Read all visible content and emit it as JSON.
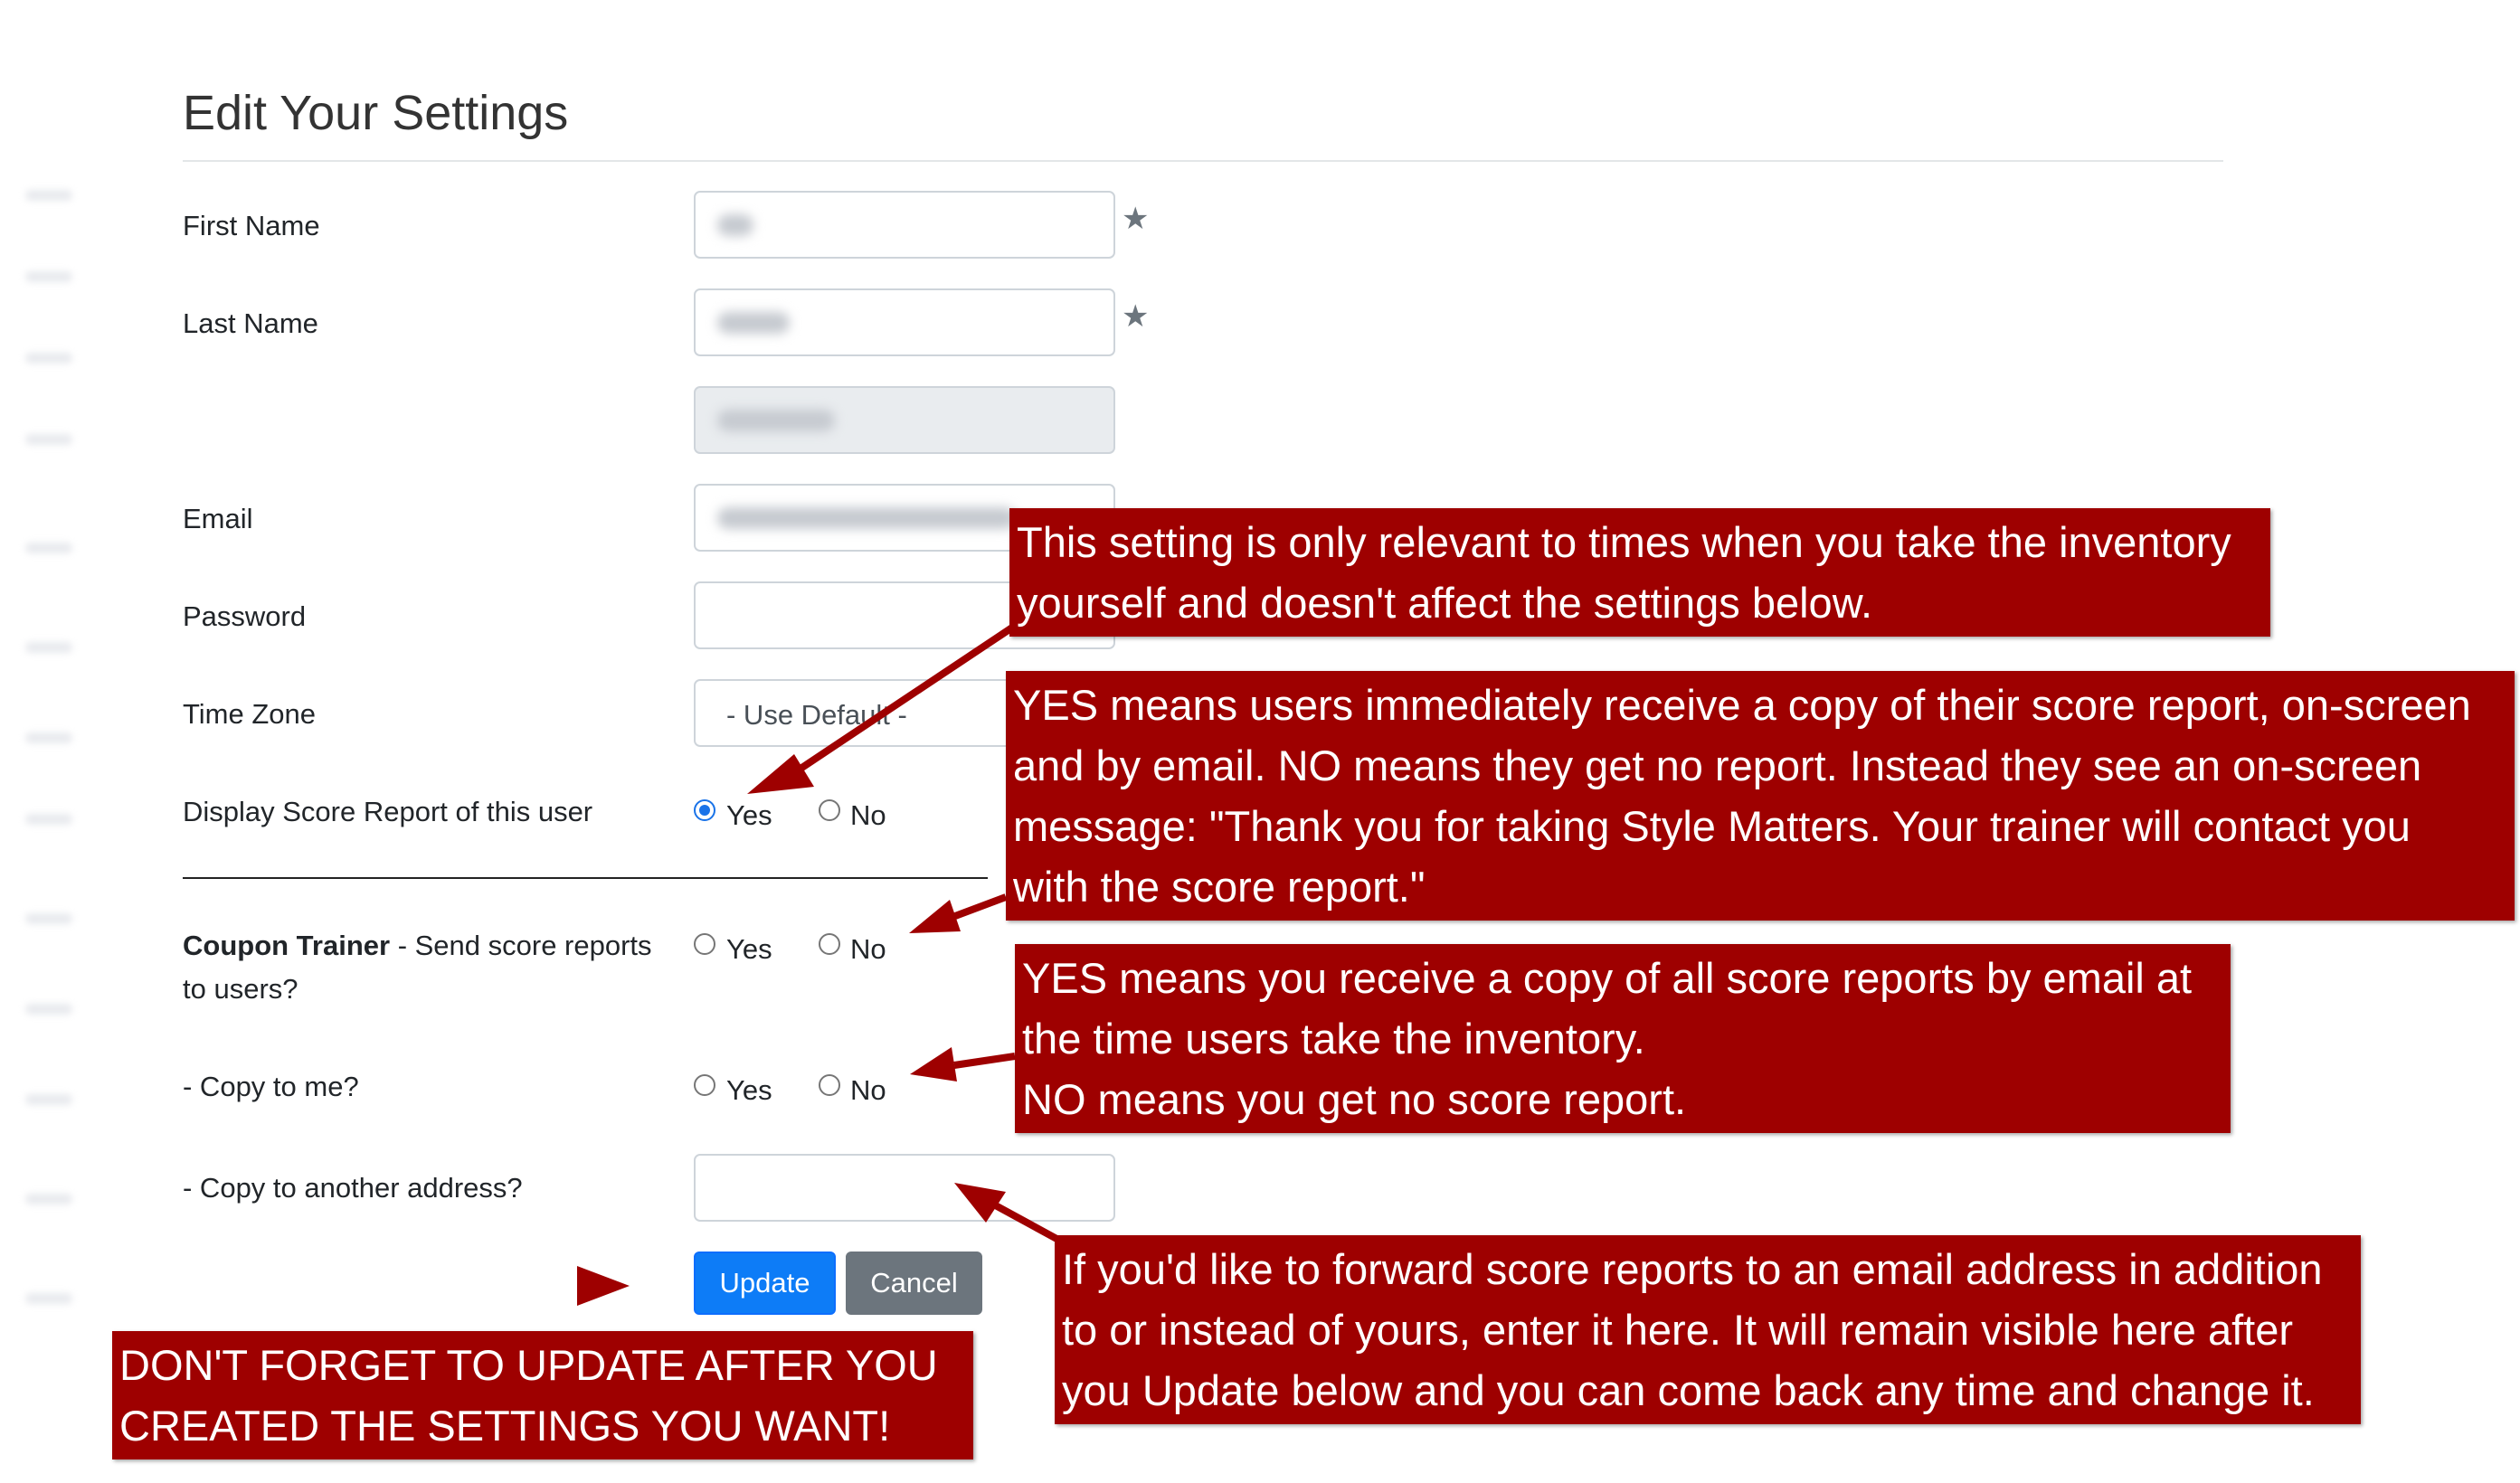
{
  "page": {
    "title": "Edit Your Settings"
  },
  "form": {
    "first_name_label": "First Name",
    "last_name_label": "Last Name",
    "email_label": "Email",
    "password_label": "Password",
    "time_zone_label": "Time Zone",
    "time_zone_value": "- Use Default -",
    "display_report_label": "Display Score Report of this user",
    "coupon_trainer_bold": "Coupon Trainer",
    "coupon_trainer_rest": " - Send score reports",
    "coupon_trainer_line2": "to users?",
    "copy_to_me_label": "- Copy to me?",
    "copy_to_other_label": "- Copy to another address?",
    "yes": "Yes",
    "no": "No",
    "required_icon": "star-icon"
  },
  "buttons": {
    "update": "Update",
    "cancel": "Cancel"
  },
  "annotations": {
    "note1": [
      "This setting is only relevant to times when you take the inventory",
      "yourself and doesn't affect the settings below."
    ],
    "note2": [
      "YES means users immediately receive a copy of their score report, on-screen",
      "and by email.  NO means they get no report.  Instead they see an on-screen",
      "message: \"Thank you for taking Style Matters.   Your trainer will contact you",
      "with the score report.\""
    ],
    "note3": [
      "YES means you receive a copy of all score reports by email at",
      "the time users take the inventory.",
      "NO means you get no score report."
    ],
    "note4": [
      "If you'd like to forward score reports to an email address in addition",
      "to or instead of yours, enter it here.  It will remain visible here after",
      "you Update below and you can come back any time and change it."
    ],
    "note5": [
      "DON'T FORGET TO UPDATE AFTER YOU",
      "CREATED THE SETTINGS YOU WANT!"
    ]
  },
  "colors": {
    "annotation_bg": "#9e0000",
    "primary": "#0d7cf7",
    "secondary": "#6c757d"
  }
}
